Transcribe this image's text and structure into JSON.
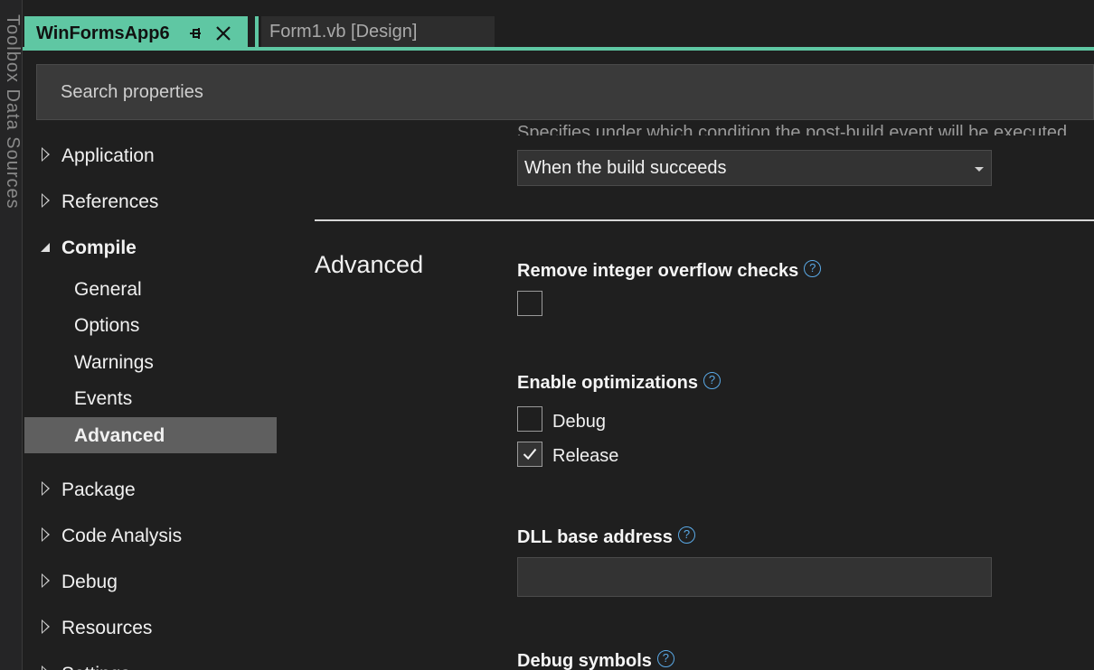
{
  "left_rail": {
    "text": "Toolbox   Data Sources"
  },
  "tabs": {
    "active_label": "WinFormsApp6",
    "inactive_label": "Form1.vb [Design]"
  },
  "search": {
    "placeholder": "Search properties"
  },
  "nav": {
    "items": [
      {
        "label": "Application"
      },
      {
        "label": "References"
      },
      {
        "label": "Compile"
      },
      {
        "label": "General"
      },
      {
        "label": "Options"
      },
      {
        "label": "Warnings"
      },
      {
        "label": "Events"
      },
      {
        "label": "Advanced"
      },
      {
        "label": "Package"
      },
      {
        "label": "Code Analysis"
      },
      {
        "label": "Debug"
      },
      {
        "label": "Resources"
      },
      {
        "label": "Settings"
      }
    ]
  },
  "content": {
    "cut_text": "Specifies under which condition the post-build event will be executed",
    "run_post_build_value": "When the build succeeds",
    "section_title": "Advanced",
    "remove_overflow_label": "Remove integer overflow checks",
    "enable_opt_label": "Enable optimizations",
    "debug_label": "Debug",
    "release_label": "Release",
    "dll_base_label": "DLL base address",
    "dll_base_value": "",
    "debug_symbols_label": "Debug symbols",
    "help_glyph": "?"
  },
  "colors": {
    "accent": "#5fc7a3",
    "help": "#5aa9e6",
    "selected": "#5f5f5f"
  }
}
